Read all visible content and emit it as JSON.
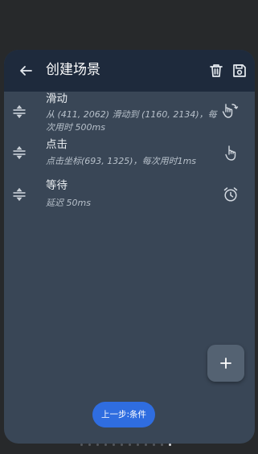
{
  "header": {
    "title": "创建场景"
  },
  "steps": [
    {
      "title": "滑动",
      "description": "从 (411, 2062) 滑动到 (1160, 2134)，每次用时 500ms",
      "icon": "swipe-icon"
    },
    {
      "title": "点击",
      "description": "点击坐标(693, 1325)，每次用时1ms",
      "icon": "tap-icon"
    },
    {
      "title": "等待",
      "description": "延迟 50ms",
      "icon": "alarm-icon"
    }
  ],
  "footer": {
    "prev_label": "上一步:条件"
  },
  "pager": {
    "count": 12,
    "active_index": 11
  },
  "colors": {
    "header_bg": "#1e2a3c",
    "sheet_bg": "#394656",
    "primary_button": "#2f6de0",
    "fab_bg": "#546272"
  }
}
